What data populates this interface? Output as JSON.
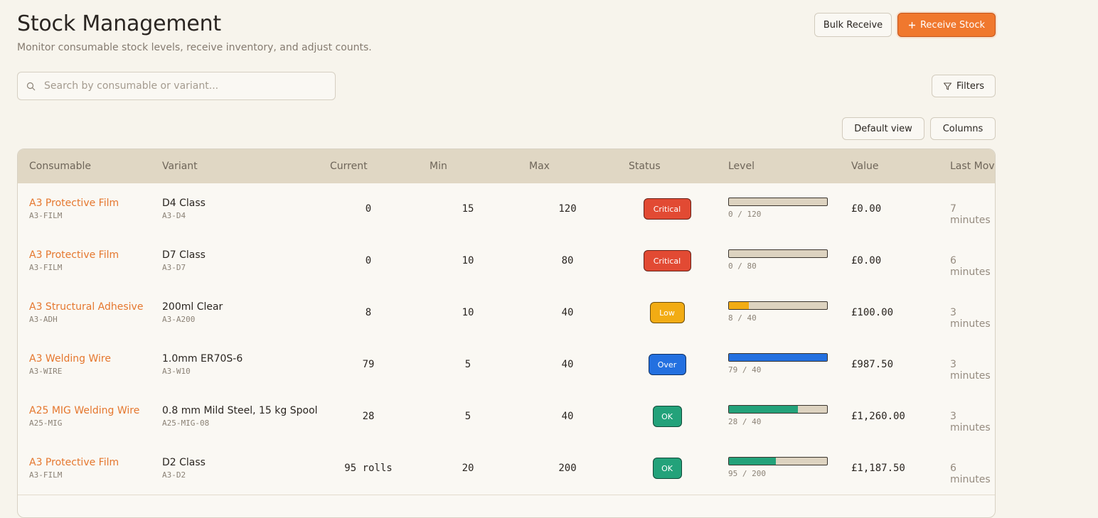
{
  "header": {
    "title": "Stock Management",
    "subtitle": "Monitor consumable stock levels, receive inventory, and adjust counts.",
    "bulk_receive": "Bulk Receive",
    "receive_stock": "Receive Stock"
  },
  "search": {
    "placeholder": "Search by consumable or variant..."
  },
  "toolbar": {
    "filters": "Filters",
    "default_view": "Default view",
    "columns": "Columns"
  },
  "table": {
    "columns": [
      "Consumable",
      "Variant",
      "Current",
      "Min",
      "Max",
      "Status",
      "Level",
      "Value",
      "Last Move"
    ],
    "rows": [
      {
        "name": "A3 Protective Film",
        "code": "A3-FILM",
        "variant": "D4 Class",
        "variant_code": "A3-D4",
        "current": "0",
        "min": "15",
        "max": "120",
        "status": "Critical",
        "level": 0,
        "level_text": "0 / 120",
        "value": "£0.00",
        "last_move": "7 minutes"
      },
      {
        "name": "A3 Protective Film",
        "code": "A3-FILM",
        "variant": "D7 Class",
        "variant_code": "A3-D7",
        "current": "0",
        "min": "10",
        "max": "80",
        "status": "Critical",
        "level": 0,
        "level_text": "0 / 80",
        "value": "£0.00",
        "last_move": "6 minutes"
      },
      {
        "name": "A3 Structural Adhesive",
        "code": "A3-ADH",
        "variant": "200ml Clear",
        "variant_code": "A3-A200",
        "current": "8",
        "min": "10",
        "max": "40",
        "status": "Low",
        "level": 0.2,
        "level_text": "8 / 40",
        "value": "£100.00",
        "last_move": "3 minutes"
      },
      {
        "name": "A3 Welding Wire",
        "code": "A3-WIRE",
        "variant": "1.0mm ER70S-6",
        "variant_code": "A3-W10",
        "current": "79",
        "min": "5",
        "max": "40",
        "status": "Over",
        "level": 1,
        "level_text": "79 / 40",
        "value": "£987.50",
        "last_move": "3 minutes"
      },
      {
        "name": "A25 MIG Welding Wire",
        "code": "A25-MIG",
        "variant": "0.8 mm Mild Steel, 15 kg Spool",
        "variant_code": "A25-MIG-08",
        "current": "28",
        "min": "5",
        "max": "40",
        "status": "OK",
        "level": 0.7,
        "level_text": "28 / 40",
        "value": "£1,260.00",
        "last_move": "3 minutes"
      },
      {
        "name": "A3 Protective Film",
        "code": "A3-FILM",
        "variant": "D2 Class",
        "variant_code": "A3-D2",
        "current": "95 rolls",
        "min": "20",
        "max": "200",
        "status": "OK",
        "level": 0.475,
        "level_text": "95 / 200",
        "value": "£1,187.50",
        "last_move": "6 minutes"
      }
    ]
  },
  "status_colors": {
    "Critical": "#e24a33",
    "Low": "#f2ac14",
    "Over": "#2370e0",
    "OK": "#23a27a"
  },
  "icons": {
    "search": "search-icon",
    "filter": "filter-icon",
    "plus": "plus-icon"
  }
}
